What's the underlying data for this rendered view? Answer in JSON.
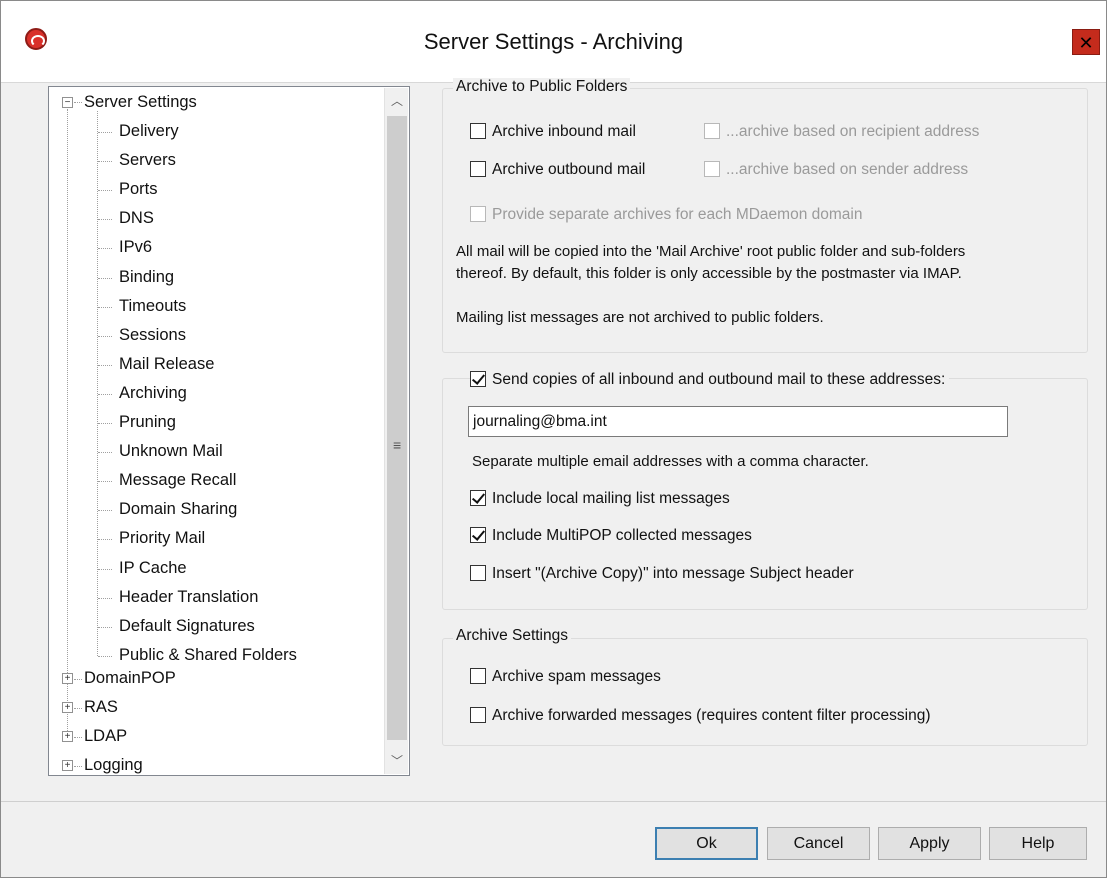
{
  "window": {
    "title": "Server Settings - Archiving",
    "close_glyph": "✕"
  },
  "tree": {
    "root": {
      "label": "Server Settings",
      "expander": "−"
    },
    "children": [
      "Delivery",
      "Servers",
      "Ports",
      "DNS",
      "IPv6",
      "Binding",
      "Timeouts",
      "Sessions",
      "Mail Release",
      "Archiving",
      "Pruning",
      "Unknown Mail",
      "Message Recall",
      "Domain Sharing",
      "Priority Mail",
      "IP Cache",
      "Header Translation",
      "Default Signatures",
      "Public & Shared Folders"
    ],
    "selected": "Archiving",
    "collapsed": [
      {
        "label": "DomainPOP",
        "expander": "+"
      },
      {
        "label": "RAS",
        "expander": "+"
      },
      {
        "label": "LDAP",
        "expander": "+"
      },
      {
        "label": "Logging",
        "expander": "+"
      }
    ]
  },
  "public_folders": {
    "title": "Archive to Public Folders",
    "archive_inbound": {
      "label": "Archive inbound mail",
      "checked": false
    },
    "archive_by_recipient": {
      "label": "...archive based on recipient address",
      "checked": false,
      "enabled": false
    },
    "archive_outbound": {
      "label": "Archive outbound mail",
      "checked": false
    },
    "archive_by_sender": {
      "label": "...archive based on sender address",
      "checked": false,
      "enabled": false
    },
    "separate_archives": {
      "label": "Provide separate archives for each MDaemon domain",
      "checked": false,
      "enabled": false
    },
    "note1_line1": "All mail will be copied into the 'Mail Archive' root public folder and sub-folders",
    "note1_line2": "thereof.  By default, this folder is only accessible by the postmaster via IMAP.",
    "note2": "Mailing list messages are not archived to public folders."
  },
  "copies": {
    "send_copies": {
      "label": "Send copies of all inbound and outbound mail to these addresses:",
      "checked": true
    },
    "addresses_value": "journaling@bma.int",
    "hint": "Separate multiple email addresses with a comma character.",
    "include_local_lists": {
      "label": "Include local mailing list messages",
      "checked": true
    },
    "include_multipop": {
      "label": "Include MultiPOP collected messages",
      "checked": true
    },
    "insert_subject": {
      "label": "Insert \"(Archive Copy)\" into message Subject header",
      "checked": false
    }
  },
  "archive_settings": {
    "title": "Archive Settings",
    "archive_spam": {
      "label": "Archive spam messages",
      "checked": false
    },
    "archive_forwarded": {
      "label": "Archive forwarded messages (requires content filter processing)",
      "checked": false
    }
  },
  "buttons": {
    "ok": "Ok",
    "cancel": "Cancel",
    "apply": "Apply",
    "help": "Help"
  }
}
